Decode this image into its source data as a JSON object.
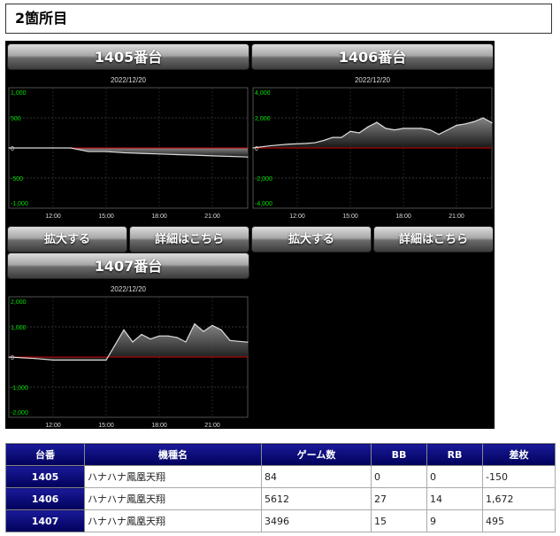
{
  "page": {
    "section_title": "2箇所目"
  },
  "machines": [
    {
      "title": "1405番台",
      "zoom_label": "拡大する",
      "detail_label": "詳細はこちら"
    },
    {
      "title": "1406番台",
      "zoom_label": "拡大する",
      "detail_label": "詳細はこちら"
    },
    {
      "title": "1407番台"
    }
  ],
  "colors": {
    "positive_axis": "#00e000",
    "zero_line": "#d00000",
    "line": "#dddddd",
    "negative_value": "#d00000",
    "header_bg": "#00006a"
  },
  "chart_data": [
    {
      "type": "area",
      "title": "2022/12/20",
      "x_ticks": [
        "12:00",
        "15:00",
        "18:00",
        "21:00"
      ],
      "y_ticks": [
        "1,000",
        "500",
        "0",
        "-500",
        "-1,000"
      ],
      "ylim": [
        -1000,
        1000
      ],
      "x_hours": [
        9.5,
        12.0,
        13.0,
        14.0,
        15.0,
        16.0,
        17.0,
        18.0,
        19.0,
        20.0,
        21.0,
        22.0,
        23.0
      ],
      "values": [
        0,
        0,
        0,
        -60,
        -60,
        -80,
        -90,
        -100,
        -110,
        -120,
        -130,
        -140,
        -150
      ]
    },
    {
      "type": "area",
      "title": "2022/12/20",
      "x_ticks": [
        "12:00",
        "15:00",
        "18:00",
        "21:00"
      ],
      "y_ticks": [
        "4,000",
        "2,000",
        "0",
        "-2,000",
        "-4,000"
      ],
      "ylim": [
        -4000,
        4000
      ],
      "x_hours": [
        9.5,
        10.5,
        11.5,
        12.5,
        13.0,
        13.5,
        14.0,
        14.5,
        15.0,
        15.5,
        16.0,
        16.5,
        17.0,
        17.5,
        18.0,
        18.5,
        19.0,
        19.5,
        20.0,
        20.5,
        21.0,
        21.5,
        22.0,
        22.5,
        23.0
      ],
      "values": [
        0,
        150,
        250,
        300,
        350,
        500,
        700,
        700,
        1100,
        1000,
        1400,
        1700,
        1300,
        1200,
        1300,
        1300,
        1300,
        1200,
        900,
        1200,
        1500,
        1600,
        1750,
        2000,
        1672
      ]
    },
    {
      "type": "area",
      "title": "2022/12/20",
      "x_ticks": [
        "12:00",
        "15:00",
        "18:00",
        "21:00"
      ],
      "y_ticks": [
        "2,000",
        "1,000",
        "0",
        "-1,000",
        "-2,000"
      ],
      "ylim": [
        -2000,
        2000
      ],
      "x_hours": [
        9.5,
        11.0,
        12.0,
        13.0,
        14.0,
        15.0,
        15.5,
        16.0,
        16.5,
        17.0,
        17.5,
        18.0,
        18.5,
        19.0,
        19.5,
        20.0,
        20.5,
        21.0,
        21.5,
        22.0,
        23.0
      ],
      "values": [
        0,
        -50,
        -100,
        -100,
        -100,
        -100,
        400,
        900,
        500,
        750,
        600,
        700,
        700,
        650,
        500,
        1100,
        850,
        1050,
        900,
        550,
        495
      ]
    }
  ],
  "table": {
    "headers": [
      "台番",
      "機種名",
      "ゲーム数",
      "BB",
      "RB",
      "差枚"
    ],
    "rows": [
      [
        "1405",
        "ハナハナ鳳凰天翔",
        "84",
        "0",
        "0",
        "-150"
      ],
      [
        "1406",
        "ハナハナ鳳凰天翔",
        "5612",
        "27",
        "14",
        "1,672"
      ],
      [
        "1407",
        "ハナハナ鳳凰天翔",
        "3496",
        "15",
        "9",
        "495"
      ]
    ]
  }
}
